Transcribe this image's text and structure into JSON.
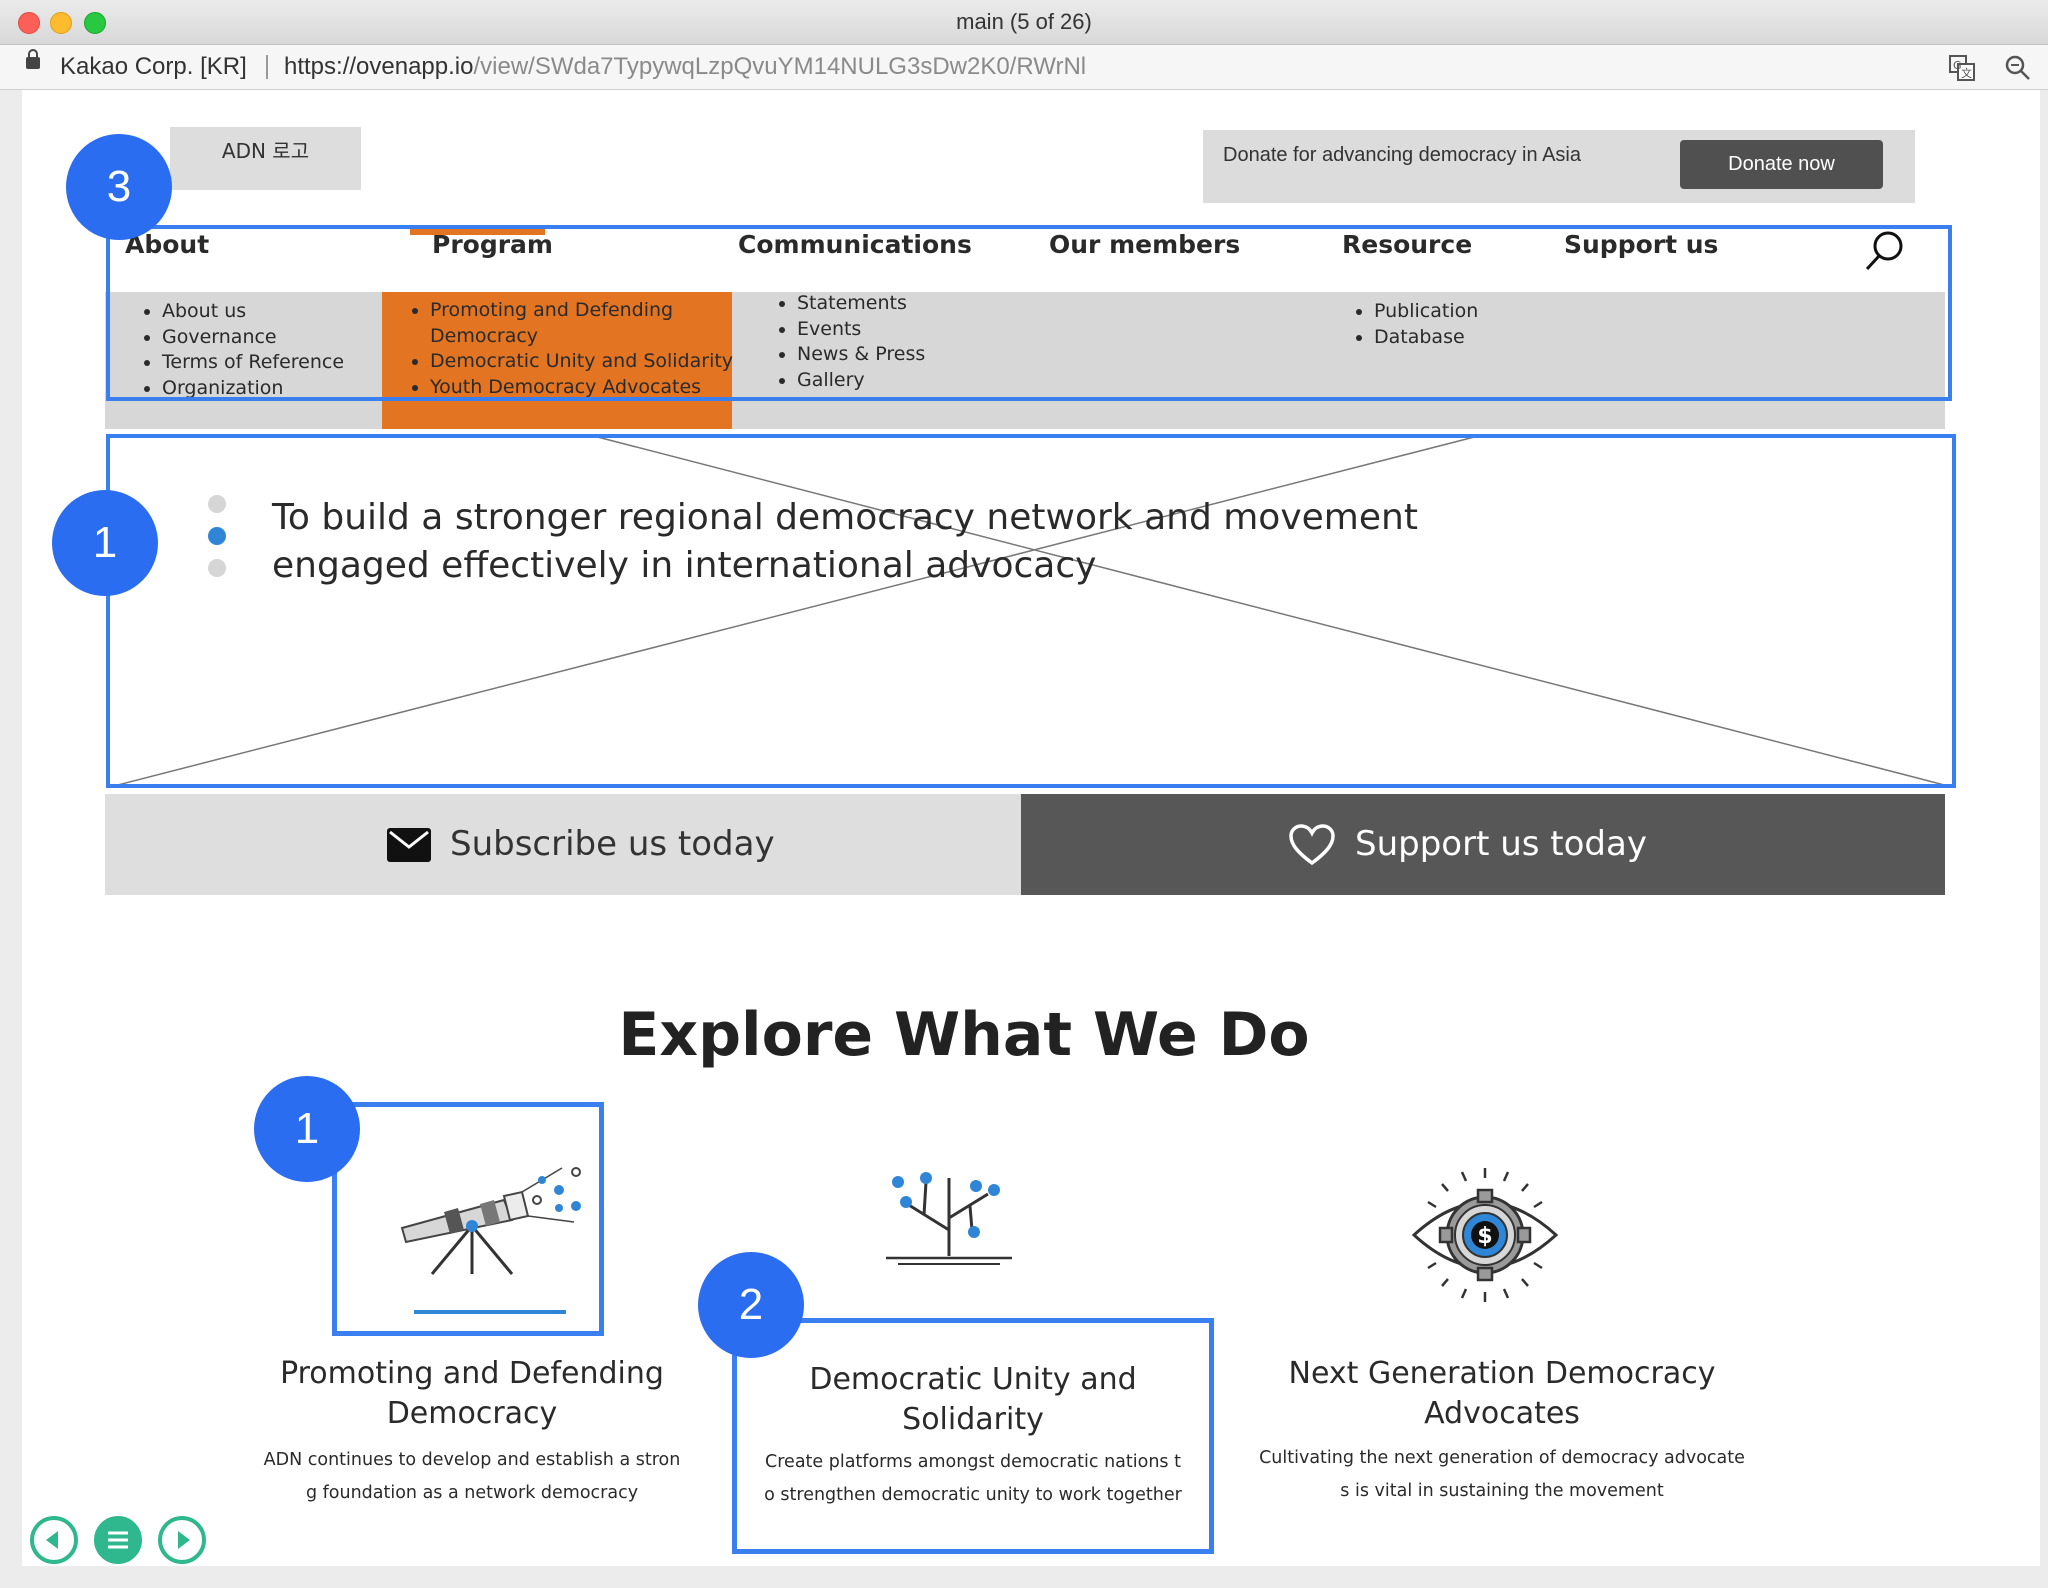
{
  "window": {
    "title": "main (5 of 26)",
    "site_owner": "Kakao Corp. [KR]",
    "url_host": "https://ovenapp.io",
    "url_path": "/view/SWda7TypywqLzpQvuYM14NULG3sDw2K0/RWrNl"
  },
  "header": {
    "logo_label": "ADN 로고",
    "donate_text": "Donate for  advancing democracy in Asia",
    "donate_button": "Donate now"
  },
  "nav": {
    "items": [
      {
        "label": "About",
        "sub": [
          "About us",
          "Governance",
          "Terms of Reference",
          "Organization"
        ]
      },
      {
        "label": "Program",
        "sub": [
          "Promoting and Defending Democracy",
          "Democratic Unity and Solidarity",
          "Youth Democracy Advocates"
        ]
      },
      {
        "label": "Communications",
        "sub": [
          "Statements",
          "Events",
          "News & Press",
          "Gallery"
        ]
      },
      {
        "label": "Our members",
        "sub": []
      },
      {
        "label": "Resource",
        "sub": [
          "Publication",
          "Database"
        ]
      },
      {
        "label": "Support us",
        "sub": []
      }
    ],
    "program_sub_line1a": "Promoting and Defending",
    "program_sub_line1b": "Democracy"
  },
  "hero": {
    "line1": "To build a stronger regional democracy network and movement",
    "line2": " engaged effectively in international advocacy",
    "active_slide": 2,
    "slide_count": 3
  },
  "cta": {
    "subscribe": "Subscribe us today",
    "support": "Support  us today"
  },
  "explore": {
    "title": "Explore What We Do",
    "cards": [
      {
        "title_1": "Promoting and Defending",
        "title_2": "Democracy",
        "desc_1": "ADN continues to develop and establish a stron",
        "desc_2": "g foundation as a network democracy",
        "icon": "telescope-icon"
      },
      {
        "title_1": "Democratic Unity and Solidarity",
        "title_2": "",
        "desc_1": "Create platforms amongst democratic nations t",
        "desc_2": "o strengthen democratic unity to work together",
        "icon": "tree-network-icon"
      },
      {
        "title_1": "Next Generation Democracy",
        "title_2": "Advocates",
        "desc_1": "Cultivating the next generation of democracy advocate",
        "desc_2": "s is vital in sustaining the movement",
        "icon": "eye-gear-dollar-icon"
      }
    ]
  },
  "annotations": {
    "badge_nav": "3",
    "badge_hero": "1",
    "badge_card1": "1",
    "badge_card2": "2"
  },
  "colors": {
    "accent_blue": "#3a7ff0",
    "badge_blue": "#2b6df0",
    "program_orange": "#e37422",
    "dark_button": "#505050",
    "player_green": "#2fb88e"
  }
}
